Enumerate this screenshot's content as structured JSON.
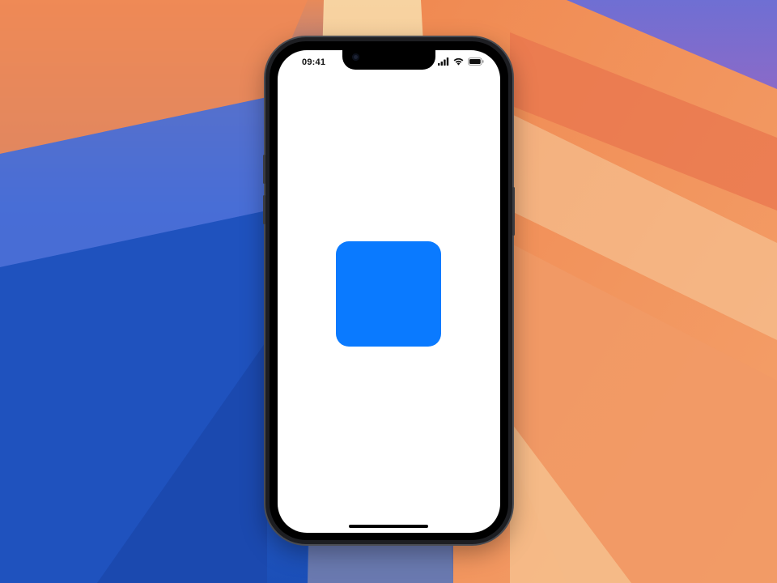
{
  "status_bar": {
    "time": "09:41",
    "signal_icon": "cellular-signal-icon",
    "wifi_icon": "wifi-icon",
    "battery_icon": "battery-icon"
  },
  "content": {
    "square_color": "#0a7aff"
  },
  "colors": {
    "screen_background": "#ffffff",
    "wallpaper_blue": "#2456c4",
    "wallpaper_orange": "#f28a4e",
    "wallpaper_peach": "#f6cfa3"
  }
}
